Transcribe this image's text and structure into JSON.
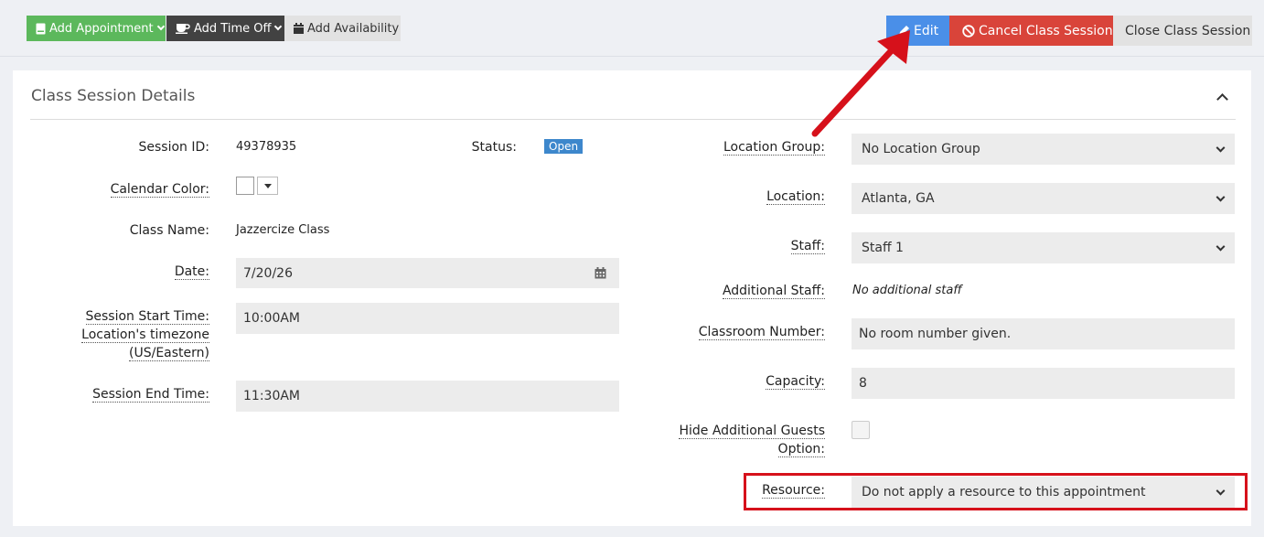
{
  "toolbar": {
    "add_appointment": "Add Appointment",
    "add_time_off": "Add Time Off",
    "add_availability": "Add Availability",
    "edit": "Edit",
    "cancel_session": "Cancel Class Session",
    "close_session": "Close Class Session"
  },
  "panel": {
    "title": "Class Session Details"
  },
  "left": {
    "session_id_label": "Session ID:",
    "session_id_value": "49378935",
    "status_label": "Status:",
    "status_value": "Open",
    "calendar_color_label": "Calendar Color:",
    "class_name_label": "Class Name:",
    "class_name_value": "Jazzercize Class",
    "date_label": "Date:",
    "date_value": "7/20/26",
    "start_time_label_line1": "Session Start Time:",
    "start_time_label_line2": "Location's timezone",
    "start_time_label_line3": "(US/Eastern)",
    "start_time_value": "10:00AM",
    "end_time_label": "Session End Time:",
    "end_time_value": "11:30AM"
  },
  "right": {
    "location_group_label": "Location Group:",
    "location_group_value": "No Location Group",
    "location_label": "Location:",
    "location_value": "Atlanta, GA",
    "staff_label": "Staff:",
    "staff_value": "Staff 1",
    "additional_staff_label": "Additional Staff:",
    "additional_staff_value": "No additional staff",
    "classroom_label": "Classroom Number:",
    "classroom_value": "No room number given.",
    "capacity_label": "Capacity:",
    "capacity_value": "8",
    "hide_guests_label_line1": "Hide Additional Guests",
    "hide_guests_label_line2": "Option:",
    "resource_label": "Resource:",
    "resource_value": "Do not apply a resource to this appointment"
  },
  "colors": {
    "green": "#5cb85c",
    "dark": "#424242",
    "blue": "#4a8fe8",
    "red": "#d9443a",
    "annotation_red": "#d6111b"
  },
  "icons": [
    "book-icon",
    "coffee-cup-icon",
    "calendar-icon",
    "pencil-icon",
    "ban-icon",
    "chevron-up-icon",
    "chevron-down-icon"
  ]
}
